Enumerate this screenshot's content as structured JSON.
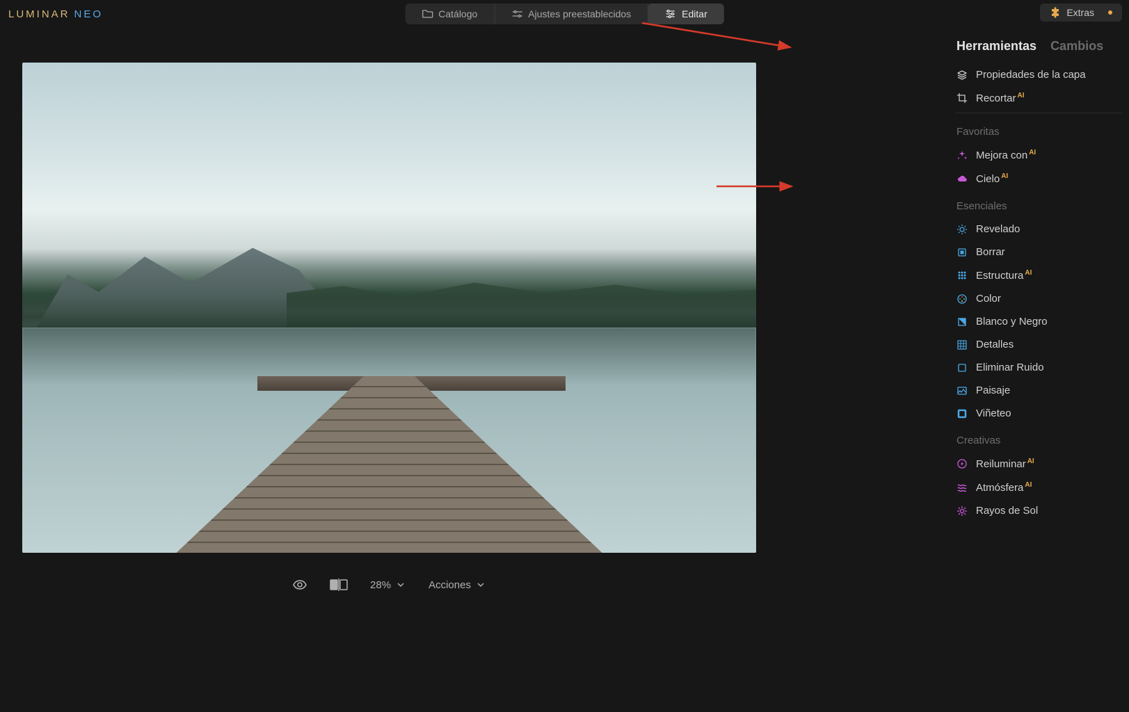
{
  "logo": {
    "seg1": "LUMINAR",
    "seg2": "NEO"
  },
  "top_tabs": {
    "catalog": "Catálogo",
    "presets": "Ajustes preestablecidos",
    "edit": "Editar"
  },
  "extras": {
    "label": "Extras"
  },
  "bottom": {
    "zoom": "28%",
    "actions": "Acciones"
  },
  "panel_tabs": {
    "tools": "Herramientas",
    "edits": "Cambios"
  },
  "tools": {
    "layer_properties": "Propiedades de la capa",
    "crop": "Recortar",
    "favorites_label": "Favoritas",
    "enhance_ai": "Mejora con",
    "sky": "Cielo",
    "essentials_label": "Esenciales",
    "develop": "Revelado",
    "erase": "Borrar",
    "structure": "Estructura",
    "color": "Color",
    "bw": "Blanco y Negro",
    "details": "Detalles",
    "denoise": "Eliminar Ruido",
    "landscape": "Paisaje",
    "vignette": "Viñeteo",
    "creative_label": "Creativas",
    "relight": "Reiluminar",
    "atmosphere": "Atmósfera",
    "sunrays": "Rayos de Sol"
  },
  "ai_badge": "AI",
  "icons": {
    "folder": "folder-icon",
    "sliders": "sliders-icon",
    "sliders2": "adjust-icon",
    "puzzle": "puzzle-icon",
    "layers": "layers-icon",
    "crop": "crop-icon",
    "sparkle": "sparkle-icon",
    "cloud": "cloud-icon",
    "sun": "sun-icon",
    "eraser": "eraser-icon",
    "dots": "dots-icon",
    "palette": "palette-icon",
    "square": "square-icon",
    "grid": "grid-icon",
    "noise": "noise-icon",
    "image": "image-icon",
    "ring": "ring-icon",
    "bolt": "bolt-icon",
    "wave": "wave-icon",
    "rays": "rays-icon",
    "eye": "eye-icon",
    "compare": "compare-icon",
    "chevdown": "chevron-down-icon"
  }
}
